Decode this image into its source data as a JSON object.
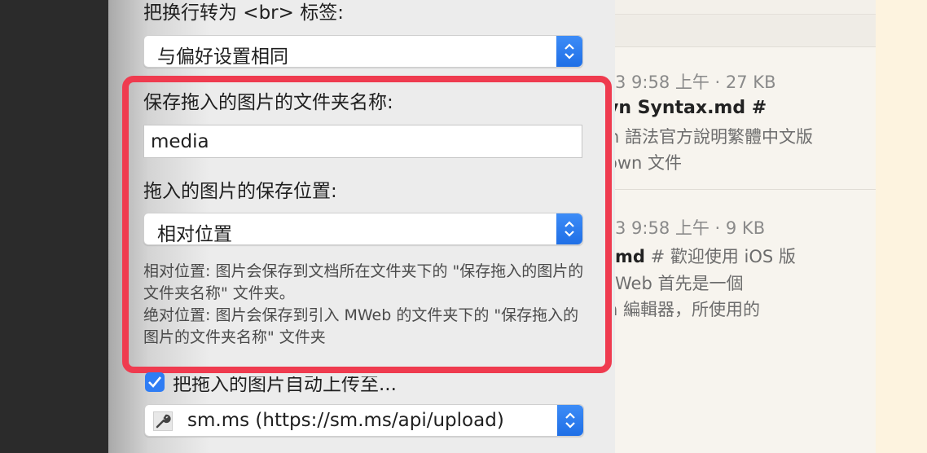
{
  "background_list": {
    "item1": {
      "meta": "3 9:58 上午 · 27 KB",
      "title": "vn Syntax.md #",
      "line1": "n 語法官方說明繁體中文版",
      "line2": "own 文件"
    },
    "item2": {
      "meta": "3 9:58 上午 · 9 KB",
      "title": ".md",
      "title_rest": " # 歡迎使用 iOS 版",
      "line1": "Web 首先是一個",
      "line2": "n 編輯器，所使用的"
    }
  },
  "preferences": {
    "br_label": "把换行转为 <br> 标签:",
    "br_select_value": "与偏好设置相同",
    "folder_name_label": "保存拖入的图片的文件夹名称:",
    "folder_name_value": "media",
    "save_location_label": "拖入的图片的保存位置:",
    "save_location_value": "相对位置",
    "help_relative": "相对位置: 图片会保存到文档所在文件夹下的 \"保存拖入的图片的文件夹名称\" 文件夹。",
    "help_absolute": "绝对位置: 图片会保存到引入 MWeb 的文件夹下的  \"保存拖入的图片的文件夹名称\" 文件夹",
    "auto_upload_label": "把拖入的图片自动上传至...",
    "upload_service_value": "sm.ms (https://sm.ms/api/upload)"
  },
  "colors": {
    "accent": "#2f7df4",
    "highlight": "#ef3b4f"
  }
}
